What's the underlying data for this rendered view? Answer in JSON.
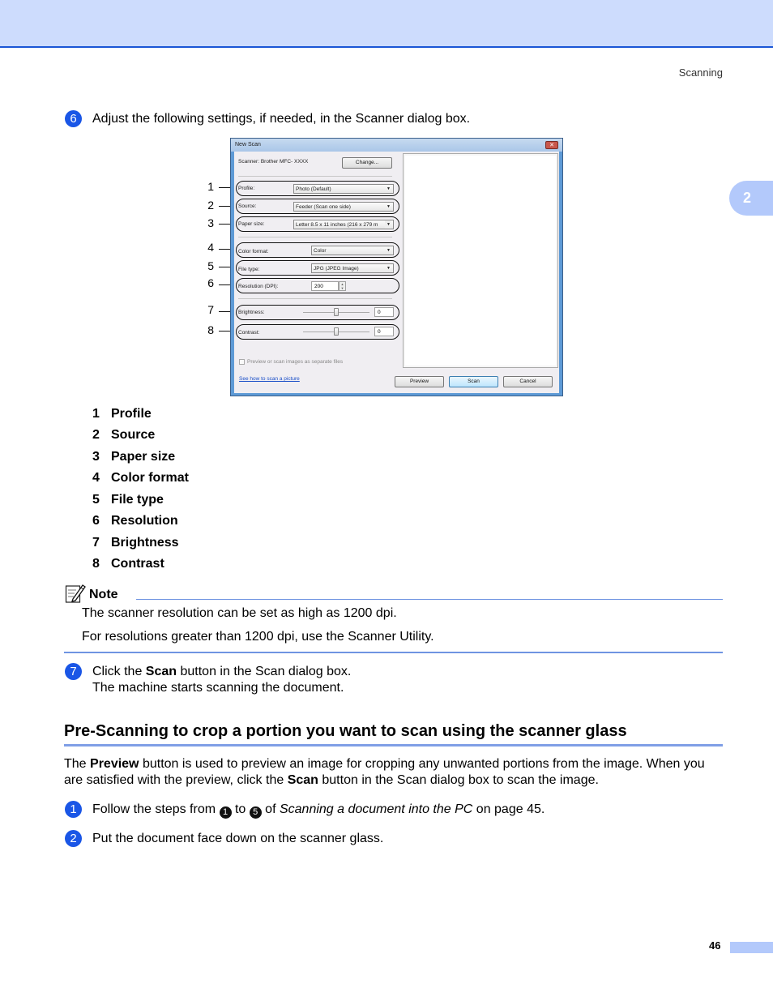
{
  "header": {
    "running_title": "Scanning",
    "chapter_tab": "2"
  },
  "step6": {
    "number": "6",
    "text": "Adjust the following settings, if needed, in the Scanner dialog box."
  },
  "dialog": {
    "title": "New Scan",
    "close_icon": "close-x",
    "close_glyph": "✕",
    "scanner_label": "Scanner: Brother MFC- XXXX",
    "change_button": "Change...",
    "profile_label": "Profile:",
    "profile_value": "Photo (Default)",
    "source_label": "Source:",
    "source_value": "Feeder (Scan one side)",
    "paper_size_label": "Paper size:",
    "paper_size_value": "Letter 8.5 x 11 inches (216 x 279 m",
    "color_format_label": "Color format:",
    "color_format_value": "Color",
    "file_type_label": "File type:",
    "file_type_value": "JPG (JPEG Image)",
    "resolution_label": "Resolution (DPI):",
    "resolution_value": "200",
    "brightness_label": "Brightness:",
    "brightness_value": "0",
    "brightness_slider_fraction": 0.5,
    "contrast_label": "Contrast:",
    "contrast_value": "0",
    "contrast_slider_fraction": 0.5,
    "separate_files_label": "Preview or scan images as separate files",
    "separate_files_checked": false,
    "help_link": "See how to scan a picture",
    "preview_button": "Preview",
    "scan_button": "Scan",
    "cancel_button": "Cancel",
    "dropdown_glyph": "▼",
    "spin_up_glyph": "▲",
    "spin_down_glyph": "▼"
  },
  "callouts": [
    "1",
    "2",
    "3",
    "4",
    "5",
    "6",
    "7",
    "8"
  ],
  "legend": [
    {
      "n": "1",
      "label": "Profile"
    },
    {
      "n": "2",
      "label": "Source"
    },
    {
      "n": "3",
      "label": "Paper size"
    },
    {
      "n": "4",
      "label": "Color format"
    },
    {
      "n": "5",
      "label": "File type"
    },
    {
      "n": "6",
      "label": "Resolution"
    },
    {
      "n": "7",
      "label": "Brightness"
    },
    {
      "n": "8",
      "label": "Contrast"
    }
  ],
  "note": {
    "icon": "note-pencil-icon",
    "title": "Note",
    "lines": [
      "The scanner resolution can be set as high as 1200 dpi.",
      "For resolutions greater than 1200 dpi, use the Scanner Utility."
    ]
  },
  "step7": {
    "number": "7",
    "pre": "Click the ",
    "bold": "Scan",
    "post": " button in the Scan dialog box.",
    "line2": "The machine starts scanning the document."
  },
  "section": {
    "heading": "Pre-Scanning to crop a portion you want to scan using the scanner glass",
    "para": {
      "p1": "The ",
      "b1": "Preview",
      "p2": " button is used to preview an image for cropping any unwanted portions from the image. When you are satisfied with the preview, click the ",
      "b2": "Scan",
      "p3": " button in the Scan dialog box to scan the image."
    },
    "steps": [
      {
        "number": "1",
        "pre": "Follow the steps from ",
        "from": "1",
        "mid": " to ",
        "to": "5",
        "of": " of ",
        "italic": "Scanning a document into the PC",
        "post": " on page 45."
      },
      {
        "number": "2",
        "text": "Put the document face down on the scanner glass."
      }
    ]
  },
  "footer": {
    "page_number": "46"
  }
}
